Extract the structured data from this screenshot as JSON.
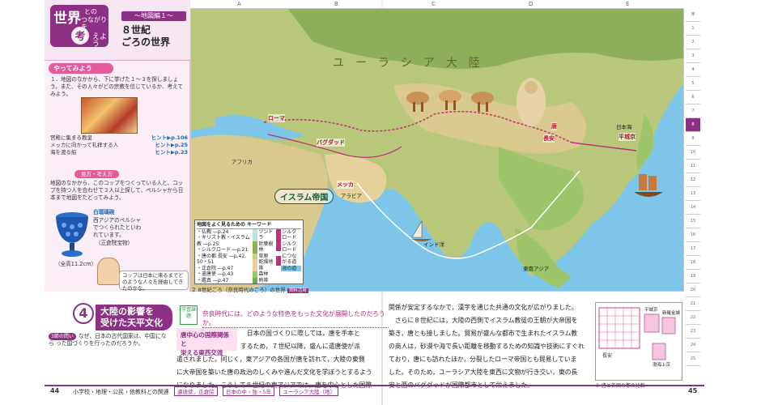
{
  "header": {
    "tag_big": "世界",
    "tag_small_1": "との",
    "tag_small_2": "つながりを",
    "tag_kangae": "考",
    "tag_kangae_rest": "えよう",
    "ribbon": "〜地図編１〜",
    "title_line1": "８世紀",
    "title_line2": "ごろの世界"
  },
  "side": {
    "try_label": "やってみよう",
    "step1": "１．地図のなかから、下に挙げた１〜３を探しましょう。また、その人々がどの宗教を信じているか、考えてみよう。",
    "step1_items": [
      {
        "text": "宮殿に集まる教皇",
        "hint": "ヒント▶p.106"
      },
      {
        "text": "メッカに向かって礼拝する人",
        "hint": "ヒント▶p.25"
      },
      {
        "text": "海を渡る船",
        "hint": "ヒント▶p.23"
      }
    ],
    "q_label": "見方・考え方",
    "step2": "地図のなかから、このコップをつくっている人と、コップを持つ人を合わせて３人以上探して、ペルシャから日本まで地図をたどってみよう。",
    "goblet_title": "白瑠璃碗",
    "goblet_desc": "西アジアのペルシャでつくられたといわれています。",
    "goblet_note": "（正倉院宝物）",
    "goblet_size": "（全高11.2cm）",
    "bubble": "コップは日本に来るまでどのような人々を経由してきたのかな。"
  },
  "map": {
    "col_labels": [
      "A",
      "B",
      "C",
      "D",
      "E"
    ],
    "row_labels": [
      "1",
      "2",
      "3"
    ],
    "eurasia": "ユーラシア大陸",
    "islam": "イスラム帝国",
    "africa": "アフリカ",
    "arabia": "アラビア",
    "india_sea": "インド洋",
    "se_asia": "東南アジア",
    "japan_sea": "日本海",
    "cities": {
      "rome": "ローマ",
      "baghdad": "バグダッド",
      "mecca": "メッカ",
      "changan": "長安",
      "heijo": "平城京",
      "tang": "唐"
    },
    "legend": {
      "title": "地図をよく見るための キーワード",
      "items": [
        "・仏教 ―p.24",
        "・キリスト教・イスラム教 ―p.25",
        "・シルクロード ―p.21",
        "・唐の都 長安 ―p.42, 50・51",
        "・正倉院 ―p.47",
        "・遣唐使 ―p.43",
        "・鑑真 ―p.47"
      ],
      "regions": [
        "ツンドラ",
        "針葉樹林",
        "草原",
        "乾燥地帯",
        "森林",
        "熱帯"
      ],
      "routes": [
        "シルクロード",
        "シルクロードにつながる道",
        "海の道"
      ]
    },
    "caption_num": "２",
    "caption": "8世紀ごろ（奈良時代のころ）の世界",
    "caption_tag": "資料活用"
  },
  "lesson": {
    "number": "4",
    "title_line1": "大陸の影響を",
    "title_line2": "受けた天平文化",
    "q_badge": "3節の問い",
    "q_text": "なぜ、日本の古代国家は、中国になら った国づくりを行ったのだろうか。",
    "topic_label": "学習課題",
    "topic_q": "奈良時代には、どのような特色をもった文化が展開したのだろうか。",
    "sub_title_1": "唐中心の国際関係と",
    "sub_title_2": "栄える東西交流",
    "body_left": [
      "　日本の国づくりに際しては，唐を手本と",
      "するため，７世紀以降，盛んに遣唐使が派",
      "遣されました。同じく，東アジアの各国が唐を訪れて，大陸の東側",
      "に大帝国を築いた唐の政治のしくみや進んだ文化を学ぼうとするよう",
      "になりました。こうして８世紀の東アジアでは，唐を中心とした国際"
    ],
    "body_right": [
      "関係が安定するなかで，漢字を通じた共通の文化が広がりました。",
      "　さらに８世紀には，大陸の西側でイスラム教徒の王朝が大帝国を",
      "築き，唐とも接しました。貿易が盛んな都市で生まれたイスラム教",
      "の商人は，砂漠や海で長い距離を移動するための知識や技術にすぐれ",
      "ており，唐にも訪れたほか，分裂したローマ帝国とも貿易していま",
      "した。そのため，ユーラシア大陸を東西に文物が行き交い，東の長",
      "安と西のバグダッドが国際都市として栄えました。"
    ],
    "plan_caption": "３ 唐と各国の都の比較",
    "plan_labels": [
      "長安",
      "平城京",
      "新羅金城",
      "渤海上京"
    ]
  },
  "footer": {
    "page_left": "44",
    "page_right": "45",
    "subject": "小学校・地理・公民・他教科との関連",
    "chip1": "遣唐使，正倉院",
    "chip2": "日本の中・独・5年",
    "chip3": "ユーラシア大陸（地）"
  },
  "tabs": [
    "序",
    "1",
    "2",
    "3",
    "4",
    "5",
    "6",
    "7",
    "8",
    "9",
    "10",
    "11",
    "12",
    "13",
    "14",
    "15",
    "16",
    "17",
    "18",
    "19",
    "20",
    "21",
    "22",
    "23",
    "24",
    "25"
  ],
  "colors": {
    "accent": "#8e2f86",
    "pink": "#e45a9a",
    "sea": "#7dc6e9"
  }
}
